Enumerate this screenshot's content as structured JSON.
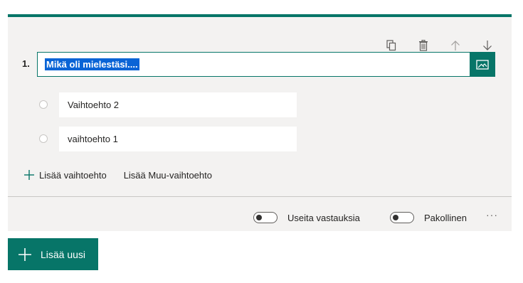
{
  "question": {
    "number": "1.",
    "title": "Mikä oli mielestäsi....",
    "options": [
      {
        "label": "Vaihtoehto 2"
      },
      {
        "label": "vaihtoehto 1"
      }
    ],
    "add_option_label": "Lisää vaihtoehto",
    "add_other_label": "Lisää Muu-vaihtoehto",
    "multiple_answers_label": "Useita vastauksia",
    "multiple_answers_on": false,
    "required_label": "Pakollinen",
    "required_on": false,
    "more_label": "···"
  },
  "toolbar": {
    "icons": [
      "copy-icon",
      "delete-icon",
      "move-up-icon",
      "move-down-icon"
    ]
  },
  "add_new": {
    "label": "Lisää uusi"
  },
  "colors": {
    "accent": "#077568",
    "card_bg": "#f3f2f1",
    "selection": "#0a64d6"
  }
}
